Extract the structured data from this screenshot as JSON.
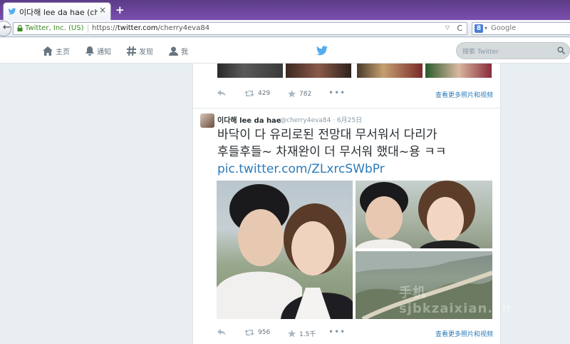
{
  "browser": {
    "tab_title": "이다해 lee da hae (cher...",
    "tab_close": "×",
    "new_tab": "+",
    "back": "←",
    "identity": "Twitter, Inc. (US)",
    "url_scheme": "https://",
    "url_host": "twitter.com",
    "url_path": "/cherry4eva84",
    "url_dropdown": "▽",
    "reload": "C",
    "search_engine_letter": "8",
    "search_dropdown": "▾",
    "search_placeholder": "Google"
  },
  "twitter_nav": {
    "home": "主页",
    "notifications": "通知",
    "discover": "发现",
    "me": "我",
    "search_placeholder": "搜索 Twitter"
  },
  "tweet_prev": {
    "retweets": "429",
    "favorites": "782",
    "more": "•••",
    "view_media": "查看更多照片和视频"
  },
  "tweet": {
    "name": "이다해 lee da hae",
    "handle_date": "@cherry4eva84 · 6月25日",
    "text_line1": "바닥이 다 유리로된 전망대 무서워서 다리가",
    "text_line2": "후들후들~ 차재완이 더 무서워 했대~용 ㅋㅋ",
    "link": "pic.twitter.com/ZLxrcSWbPr",
    "retweets": "956",
    "favorites": "1.5千",
    "more": "•••",
    "view_media": "查看更多照片和视频"
  },
  "watermark": "手机\nsjbkzaixian.cn",
  "colors": {
    "tab_bar": "#6b46a0",
    "twitter_blue": "#55acee",
    "link": "#2b7bb9"
  }
}
